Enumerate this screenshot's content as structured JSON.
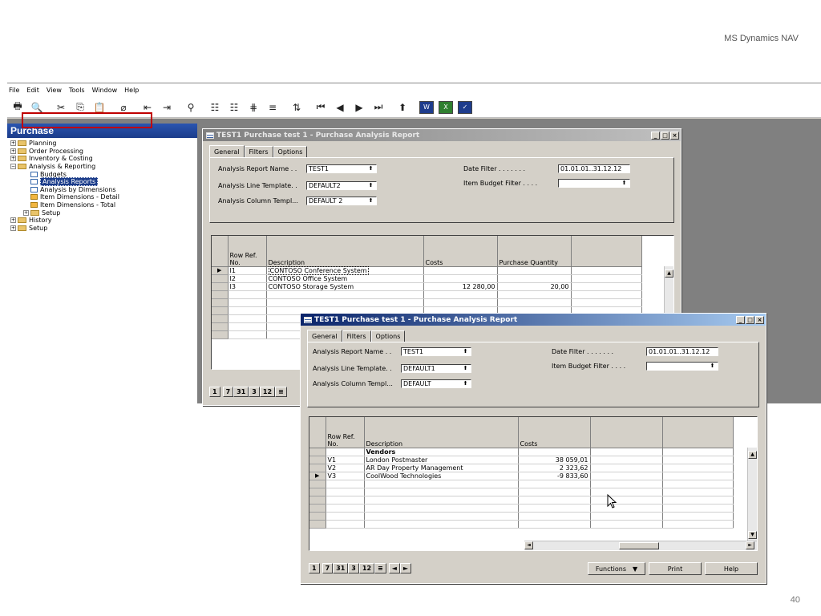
{
  "slide": {
    "title": "MS Dynamics NAV",
    "page_number": "40"
  },
  "menu": [
    "File",
    "Edit",
    "View",
    "Tools",
    "Window",
    "Help"
  ],
  "nav": {
    "header": "Purchase",
    "items": [
      {
        "label": "Planning",
        "level": 0,
        "type": "folder",
        "exp": "+"
      },
      {
        "label": "Order Processing",
        "level": 0,
        "type": "folder",
        "exp": "+"
      },
      {
        "label": "Inventory & Costing",
        "level": 0,
        "type": "folder",
        "exp": "+"
      },
      {
        "label": "Analysis & Reporting",
        "level": 0,
        "type": "folder-open",
        "exp": "-"
      },
      {
        "label": "Budgets",
        "level": 1,
        "type": "doc"
      },
      {
        "label": "Analysis Reports",
        "level": 1,
        "type": "doc",
        "selected": true
      },
      {
        "label": "Analysis by Dimensions",
        "level": 1,
        "type": "doc"
      },
      {
        "label": "Item Dimensions - Detail",
        "level": 1,
        "type": "dochi"
      },
      {
        "label": "Item Dimensions - Total",
        "level": 1,
        "type": "dochi"
      },
      {
        "label": "Setup",
        "level": 1,
        "type": "folder",
        "exp": "+"
      },
      {
        "label": "History",
        "level": 0,
        "type": "folder",
        "exp": "+"
      },
      {
        "label": "Setup",
        "level": 0,
        "type": "folder",
        "exp": "+"
      }
    ]
  },
  "window1": {
    "title": "TEST1 Purchase test 1 - Purchase Analysis Report",
    "tabs": [
      "General",
      "Filters",
      "Options"
    ],
    "fields": {
      "report_name_label": "Analysis Report Name . .",
      "report_name": "TEST1",
      "line_template_label": "Analysis Line Template. .",
      "line_template": "DEFAULT2",
      "column_template_label": "Analysis Column Templ...",
      "column_template": "DEFAULT 2",
      "date_filter_label": "Date Filter . . . . . . .",
      "date_filter": "01.01.01..31.12.12",
      "budget_filter_label": "Item Budget Filter . . . .",
      "budget_filter": ""
    },
    "columns": [
      "Row Ref.\nNo.",
      "Description",
      "Costs",
      "Purchase Quantity",
      ""
    ],
    "rows": [
      {
        "ref": "I1",
        "desc": "CONTOSO Conference System",
        "costs": "",
        "qty": "",
        "current": true
      },
      {
        "ref": "I2",
        "desc": "CONTOSO Office System",
        "costs": "",
        "qty": ""
      },
      {
        "ref": "I3",
        "desc": "CONTOSO Storage System",
        "costs": "12 280,00",
        "qty": "20,00"
      }
    ],
    "nav_buttons": [
      "1",
      "7",
      "31",
      "3",
      "12",
      "≡"
    ]
  },
  "window2": {
    "title": "TEST1 Purchase test 1 - Purchase Analysis Report",
    "tabs": [
      "General",
      "Filters",
      "Options"
    ],
    "fields": {
      "report_name_label": "Analysis Report Name . .",
      "report_name": "TEST1",
      "line_template_label": "Analysis Line Template. .",
      "line_template": "DEFAULT1",
      "column_template_label": "Analysis Column Templ...",
      "column_template": "DEFAULT",
      "date_filter_label": "Date Filter . . . . . . .",
      "date_filter": "01.01.01..31.12.12",
      "budget_filter_label": "Item Budget Filter . . . .",
      "budget_filter": ""
    },
    "columns": [
      "Row Ref.\nNo.",
      "Description",
      "Costs",
      "",
      ""
    ],
    "rows": [
      {
        "ref": "",
        "desc": "Vendors",
        "costs": "",
        "bold": true
      },
      {
        "ref": "V1",
        "desc": "London Postmaster",
        "costs": "38 059,01"
      },
      {
        "ref": "V2",
        "desc": "AR Day Property Management",
        "costs": "2 323,62"
      },
      {
        "ref": "V3",
        "desc": "CoolWood Technologies",
        "costs": "-9 833,60",
        "current": true
      }
    ],
    "nav_buttons": [
      "1",
      "7",
      "31",
      "3",
      "12",
      "≡",
      "◄",
      "►"
    ],
    "buttons": {
      "functions": "Functions",
      "print": "Print",
      "help": "Help"
    }
  }
}
